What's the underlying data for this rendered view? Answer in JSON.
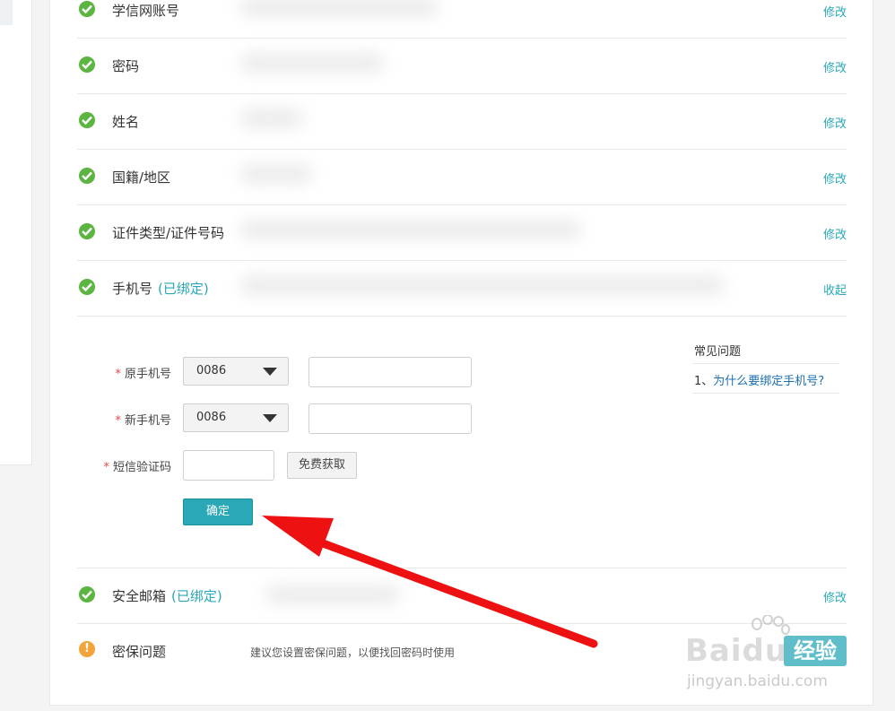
{
  "rows": [
    {
      "label": "学信网账号",
      "bound": "",
      "action": "修改",
      "status": "ok"
    },
    {
      "label": "密码",
      "bound": "",
      "action": "修改",
      "status": "ok"
    },
    {
      "label": "姓名",
      "bound": "",
      "action": "修改",
      "status": "ok"
    },
    {
      "label": "国籍/地区",
      "bound": "",
      "action": "修改",
      "status": "ok"
    },
    {
      "label": "证件类型/证件号码",
      "bound": "",
      "action": "修改",
      "status": "ok"
    },
    {
      "label": "手机号",
      "bound": "(已绑定)",
      "action": "收起",
      "status": "ok"
    },
    {
      "label": "安全邮箱",
      "bound": "(已绑定)",
      "action": "修改",
      "status": "ok"
    },
    {
      "label": "密保问题",
      "tip": "建议您设置密保问题，以便找回密码时使用",
      "status": "warn"
    }
  ],
  "phone_form": {
    "required_mark": "*",
    "old_phone_label": "原手机号",
    "new_phone_label": "新手机号",
    "sms_label": "短信验证码",
    "country_code": "0086",
    "get_code_button": "免费获取",
    "confirm_button": "确定"
  },
  "faq": {
    "title": "常见问题",
    "items": [
      {
        "prefix": "1、",
        "text": "为什么要绑定手机号?"
      }
    ]
  },
  "watermark": {
    "text": "Baidu",
    "badge": "经验",
    "url": "jingyan.baidu.com"
  },
  "colors": {
    "accent": "#2aa8b8",
    "ok": "#5bb540",
    "warn": "#f2a43a",
    "arrow": "#ee1111",
    "link": "#1a6fb0"
  },
  "icons": [
    "check-circle-icon",
    "exclamation-circle-icon",
    "caret-down-icon",
    "red-arrow-annotation",
    "baidu-paw-icon"
  ]
}
